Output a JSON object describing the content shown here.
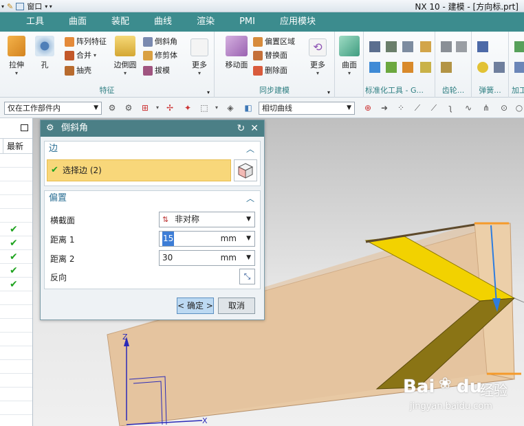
{
  "titlebar": {
    "quick_access": "窗口",
    "title": "NX 10 - 建模 - [方向标.prt]"
  },
  "menu": [
    "工具",
    "曲面",
    "装配",
    "曲线",
    "渲染",
    "PMI",
    "应用模块"
  ],
  "ribbon": {
    "feature_group": {
      "label": "特征",
      "extrude": "拉伸",
      "hole": "孔",
      "pattern": "阵列特征",
      "combine": "合并",
      "shell": "抽壳",
      "edge_blend": "边倒圆",
      "chamfer": "倒斜角",
      "trim_body": "修剪体",
      "draft": "拔模",
      "more": "更多"
    },
    "sync_group": {
      "label": "同步建模",
      "move_face": "移动面",
      "offset_region": "偏置区域",
      "replace_face": "替换面",
      "delete_face": "删除面",
      "more": "更多"
    },
    "surface_group": {
      "surface": "曲面"
    },
    "tools_groups": {
      "standard": "标准化工具 - G...",
      "gear": "齿轮...",
      "spring": "弹簧...",
      "process": "加工"
    }
  },
  "command_bar": {
    "filter": "仅在工作部件内",
    "curve_rule": "相切曲线"
  },
  "navigator": {
    "column_header": "最新",
    "checked_rows": 5
  },
  "dialog": {
    "title": "倒斜角",
    "edge_section": "边",
    "select_edge": "选择边 (2)",
    "offset_section": "偏置",
    "cross_section_label": "横截面",
    "cross_section_value": "非对称",
    "distance1_label": "距离 1",
    "distance1_value": "15",
    "distance1_unit": "mm",
    "distance2_label": "距离 2",
    "distance2_value": "30",
    "distance2_unit": "mm",
    "reverse_label": "反向",
    "ok_button": "< 确定 >",
    "cancel_button": "取消"
  },
  "viewport": {
    "axis_z": "Z",
    "axis_x": "X"
  },
  "watermark": {
    "brand": "Bai",
    "brand2": "du",
    "cn": "经验",
    "url": "jingyan.baidu.com"
  }
}
